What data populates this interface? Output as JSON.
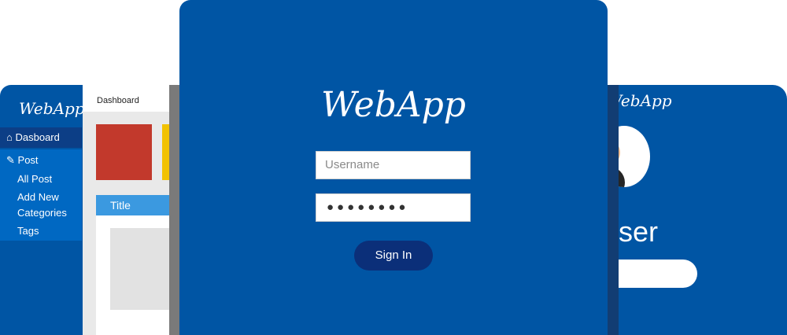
{
  "dashboard": {
    "logo": "WebApp",
    "header_title": "Dashboard",
    "sidebar": {
      "active_item": {
        "label": "Dasboard",
        "icon": "home-icon"
      },
      "post_item": {
        "label": "Post",
        "icon": "pin-icon"
      },
      "children": [
        "All Post",
        "Add New",
        "Categories",
        "Tags"
      ]
    },
    "title_bar_label": "Title",
    "colors": {
      "red": "#c2392c",
      "yellow": "#f2c200",
      "blue": "#3b99e0"
    }
  },
  "login": {
    "logo": "WebApp",
    "username_placeholder": "Username",
    "password_value": "●●●●●●●●",
    "signin_label": "Sign In",
    "colors": {
      "background": "#0055a4",
      "button": "#0b2f79"
    }
  },
  "profile": {
    "logo": "WebApp",
    "user_label": "User"
  }
}
